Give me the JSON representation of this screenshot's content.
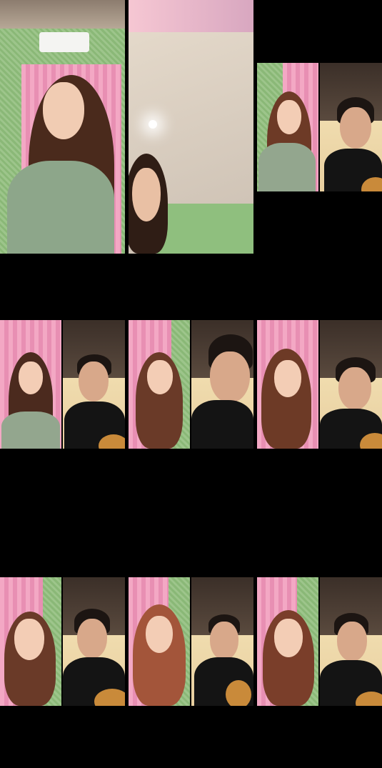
{
  "frames": [
    {
      "id": "frame-1",
      "kind": "solo-girl"
    },
    {
      "id": "frame-2",
      "kind": "ceiling-view"
    },
    {
      "id": "frame-3",
      "kind": "duet"
    },
    {
      "id": "frame-4",
      "kind": "duet"
    },
    {
      "id": "frame-5",
      "kind": "duet"
    },
    {
      "id": "frame-6",
      "kind": "duet"
    },
    {
      "id": "frame-7",
      "kind": "duet"
    },
    {
      "id": "frame-8",
      "kind": "duet"
    },
    {
      "id": "frame-9",
      "kind": "duet"
    }
  ],
  "colors": {
    "background": "#000000",
    "curtain_pink": "#f3a8c4",
    "wall_green": "#9dc58b",
    "ceiling": "#d9cfc4",
    "shirt_black": "#141414",
    "dress_green": "#8fa58a",
    "hair_dark": "#3a2418",
    "skin": "#f1c9b0"
  }
}
